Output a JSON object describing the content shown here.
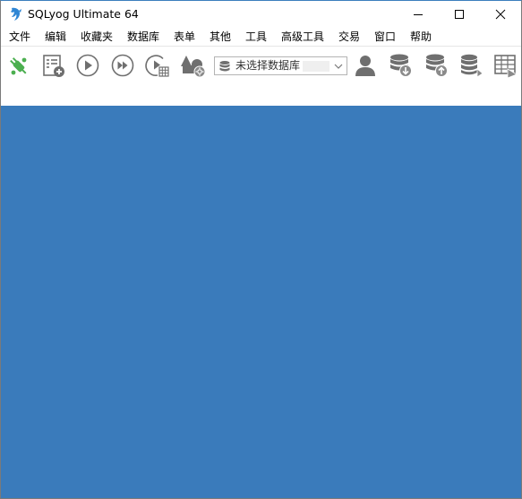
{
  "window": {
    "title": "SQLyog Ultimate 64"
  },
  "window_controls": {
    "minimize": "minimize-icon",
    "maximize": "maximize-icon",
    "close": "close-icon"
  },
  "menu": {
    "items": [
      "文件",
      "编辑",
      "收藏夹",
      "数据库",
      "表单",
      "其他",
      "工具",
      "高级工具",
      "交易",
      "窗口",
      "帮助"
    ]
  },
  "toolbar": {
    "buttons": [
      {
        "name": "new-connection-button",
        "icon": "plug-icon"
      },
      {
        "name": "new-query-editor-button",
        "icon": "query-add-icon"
      },
      {
        "name": "execute-query-button",
        "icon": "play-icon"
      },
      {
        "name": "execute-all-button",
        "icon": "fast-forward-icon"
      },
      {
        "name": "execute-and-edit-button",
        "icon": "play-grid-icon"
      },
      {
        "name": "schema-designer-button",
        "icon": "shapes-icon"
      },
      {
        "name": "user-manager-button",
        "icon": "user-icon"
      },
      {
        "name": "backup-database-button",
        "icon": "db-download-icon"
      },
      {
        "name": "restore-database-button",
        "icon": "db-upload-icon"
      },
      {
        "name": "db-sync-button",
        "icon": "db-sync-icon"
      },
      {
        "name": "table-export-button",
        "icon": "table-export-icon"
      }
    ],
    "database_select": {
      "value": "未选择数据库",
      "icon": "database-icon"
    }
  },
  "colors": {
    "workspace": "#3a7bbb",
    "accent_green": "#4caf50",
    "icon_gray": "#6f6f6f"
  }
}
